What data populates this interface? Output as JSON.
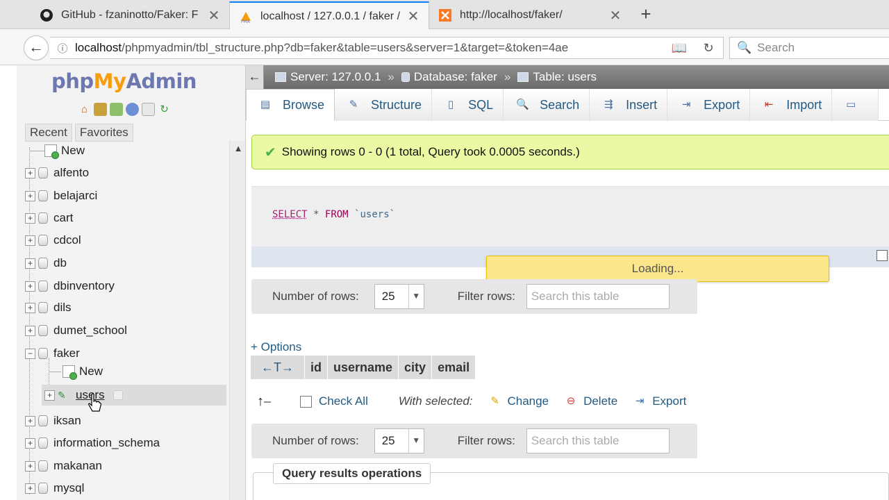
{
  "browser": {
    "tabs": [
      {
        "title": "GitHub - fzaninotto/Faker: F",
        "icon": "github-icon"
      },
      {
        "title": "localhost / 127.0.0.1 / faker /",
        "icon": "phpmyadmin-icon"
      },
      {
        "title": "http://localhost/faker/",
        "icon": "xampp-icon"
      }
    ],
    "url_host": "localhost",
    "url_path": "/phpmyadmin/tbl_structure.php?db=faker&table=users&server=1&target=&token=4ae",
    "search_placeholder": "Search"
  },
  "nav": {
    "logo": {
      "php": "php",
      "my": "My",
      "admin": "Admin"
    },
    "recent_label": "Recent",
    "favorites_label": "Favorites",
    "tree": {
      "new_label": "New",
      "databases": [
        "alfento",
        "belajarci",
        "cart",
        "cdcol",
        "db",
        "dbinventory",
        "dils",
        "dumet_school"
      ],
      "faker": "faker",
      "faker_new": "New",
      "faker_users": "users",
      "databases_after": [
        "iksan",
        "information_schema",
        "makanan",
        "mysql"
      ]
    }
  },
  "breadcrumb": {
    "server": "Server: 127.0.0.1",
    "database": "Database: faker",
    "table": "Table: users"
  },
  "tabs": [
    "Browse",
    "Structure",
    "SQL",
    "Search",
    "Insert",
    "Export",
    "Import"
  ],
  "message": "Showing rows 0 - 0 (1 total, Query took 0.0005 seconds.)",
  "sql": {
    "select": "SELECT",
    "star": "*",
    "from": "FROM",
    "table": "`users`"
  },
  "loading": "Loading...",
  "rows_controls": {
    "number_of_rows_label": "Number of rows:",
    "number_of_rows_value": "25",
    "filter_label": "Filter rows:",
    "filter_placeholder": "Search this table"
  },
  "options_label": "+ Options",
  "columns": [
    "id",
    "username",
    "city",
    "email"
  ],
  "with_selected": {
    "check_all": "Check All",
    "label": "With selected:",
    "change": "Change",
    "delete": "Delete",
    "export": "Export"
  },
  "query_ops_label": "Query results operations"
}
